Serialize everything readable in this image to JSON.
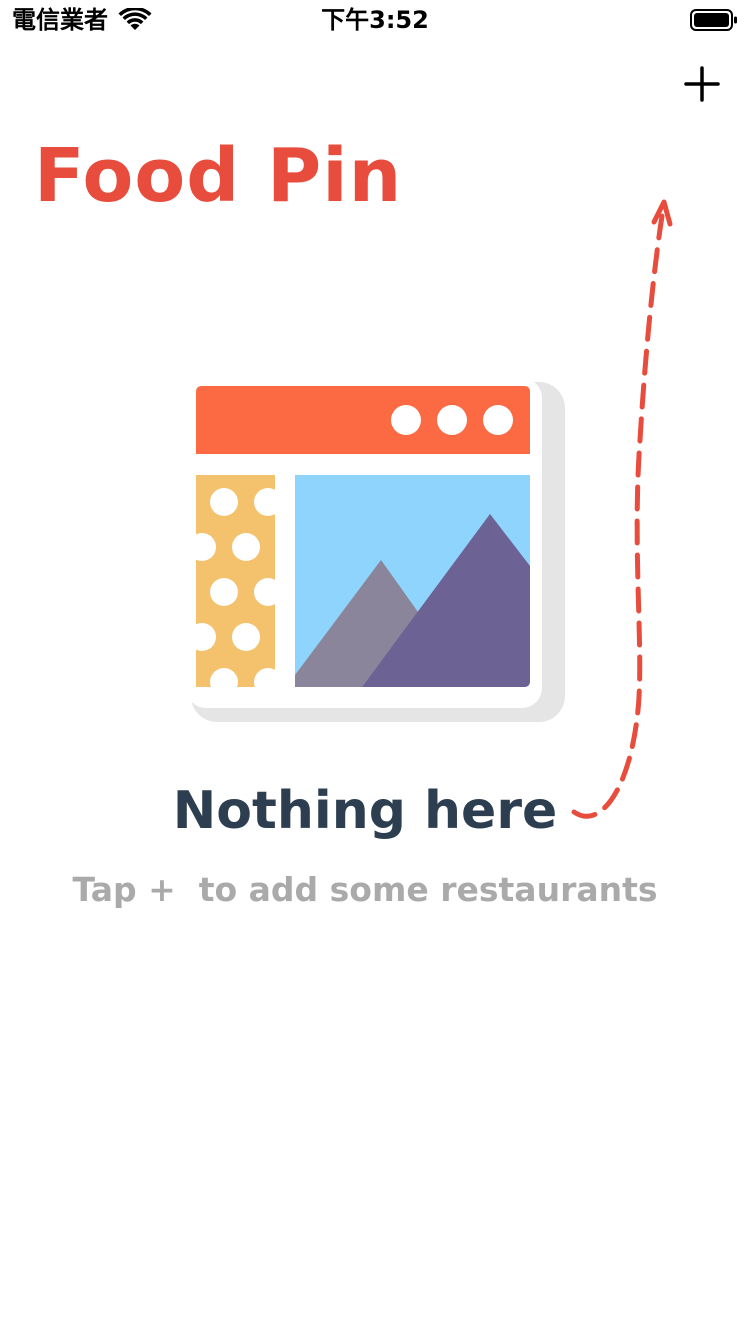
{
  "status_bar": {
    "carrier": "電信業者",
    "time": "下午3:52",
    "wifi_icon": "wifi-icon",
    "battery_icon": "battery-icon"
  },
  "nav": {
    "add_icon": "plus-icon"
  },
  "page": {
    "title": "Food Pin"
  },
  "empty_state": {
    "illustration": "empty-browser-image-illustration",
    "heading": "Nothing here",
    "subtitle": "Tap +  to add some restaurants",
    "arrow": "dashed-arrow-to-add-button"
  },
  "colors": {
    "title": "#E74C3C",
    "heading": "#2C3E50",
    "subtitle": "#AAAAAA",
    "arrow": "#E74C3C",
    "window_bar": "#FC6A43",
    "window_shadow": "#E5E5E5",
    "panel_yellow": "#F4C16D",
    "sky": "#8ED4FC",
    "mountain_back": "#8A859B",
    "mountain_front": "#6C6294"
  }
}
